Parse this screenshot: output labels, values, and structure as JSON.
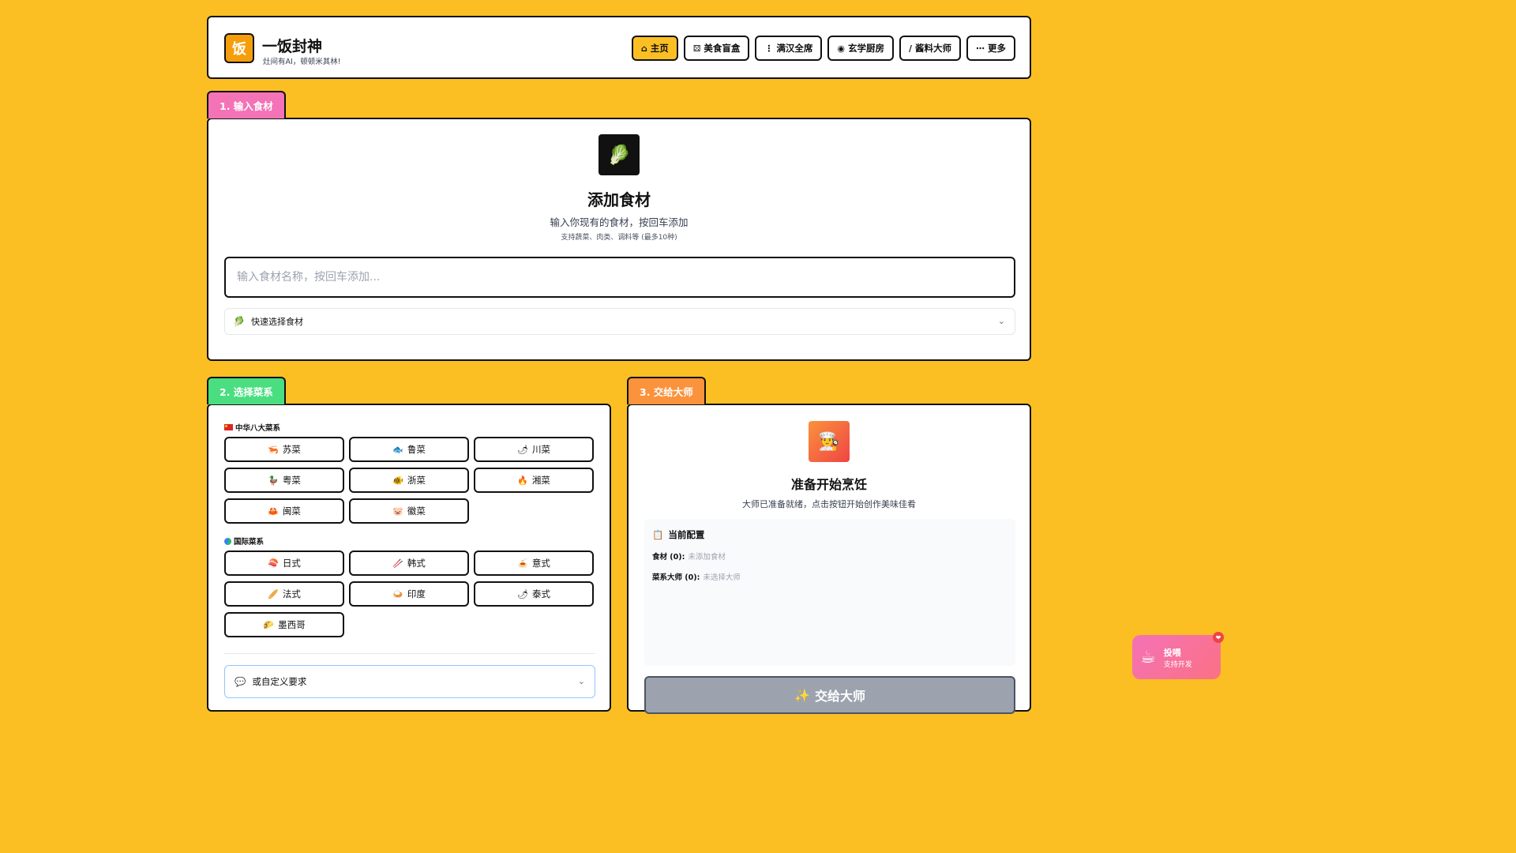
{
  "header": {
    "logo_char": "饭",
    "title": "一饭封神",
    "subtitle": "灶间有AI，顿顿米其林!",
    "nav": [
      {
        "icon": "⌂",
        "label": "主页",
        "active": true
      },
      {
        "icon": "⚄",
        "label": "美食盲盒"
      },
      {
        "icon": "⋮",
        "label": "满汉全席"
      },
      {
        "icon": "◉",
        "label": "玄学厨房"
      },
      {
        "icon": "∕",
        "label": "酱料大师"
      },
      {
        "icon": "⋯",
        "label": "更多"
      }
    ]
  },
  "step1": {
    "tab_label": "1. 输入食材",
    "icon": "🥬",
    "title": "添加食材",
    "subtitle": "输入你现有的食材，按回车添加",
    "hint": "支持蔬菜、肉类、调料等 (最多10种)",
    "input_placeholder": "输入食材名称，按回车添加...",
    "input_value": "",
    "quick_select_label": "快速选择食材",
    "quick_select_icon": "🥬"
  },
  "step2": {
    "tab_label": "2. 选择菜系",
    "chinese_label": "中华八大菜系",
    "chinese": [
      {
        "icon": "🦐",
        "label": "苏菜"
      },
      {
        "icon": "🐟",
        "label": "鲁菜"
      },
      {
        "icon": "🌶",
        "label": "川菜"
      },
      {
        "icon": "🦆",
        "label": "粤菜"
      },
      {
        "icon": "🐠",
        "label": "浙菜"
      },
      {
        "icon": "🔥",
        "label": "湘菜"
      },
      {
        "icon": "🦀",
        "label": "闽菜"
      },
      {
        "icon": "🐷",
        "label": "徽菜"
      }
    ],
    "intl_label": "国际菜系",
    "international": [
      {
        "icon": "🍣",
        "label": "日式"
      },
      {
        "icon": "🥢",
        "label": "韩式"
      },
      {
        "icon": "🍝",
        "label": "意式"
      },
      {
        "icon": "🥖",
        "label": "法式"
      },
      {
        "icon": "🍛",
        "label": "印度"
      },
      {
        "icon": "🌶",
        "label": "泰式"
      },
      {
        "icon": "🌮",
        "label": "墨西哥"
      }
    ],
    "custom_label": "或自定义要求",
    "custom_icon": "💬"
  },
  "step3": {
    "tab_label": "3. 交给大师",
    "icon": "👨‍🍳",
    "title": "准备开始烹饪",
    "subtitle": "大师已准备就绪，点击按钮开始创作美味佳肴",
    "config_title": "当前配置",
    "config_icon": "📋",
    "ingredients_label": "食材 (0):",
    "ingredients_value": "未添加食材",
    "masters_label": "菜系大师 (0):",
    "masters_value": "未选择大师",
    "button_icon": "✨",
    "button_label": "交给大师"
  },
  "tip": {
    "icon": "☕",
    "title": "投喂",
    "subtitle": "支持开发",
    "badge": "❤"
  },
  "colors": {
    "background": "#fbbf24",
    "tab1": "#f472b6",
    "tab2": "#4ade80",
    "tab3": "#fb923c"
  }
}
